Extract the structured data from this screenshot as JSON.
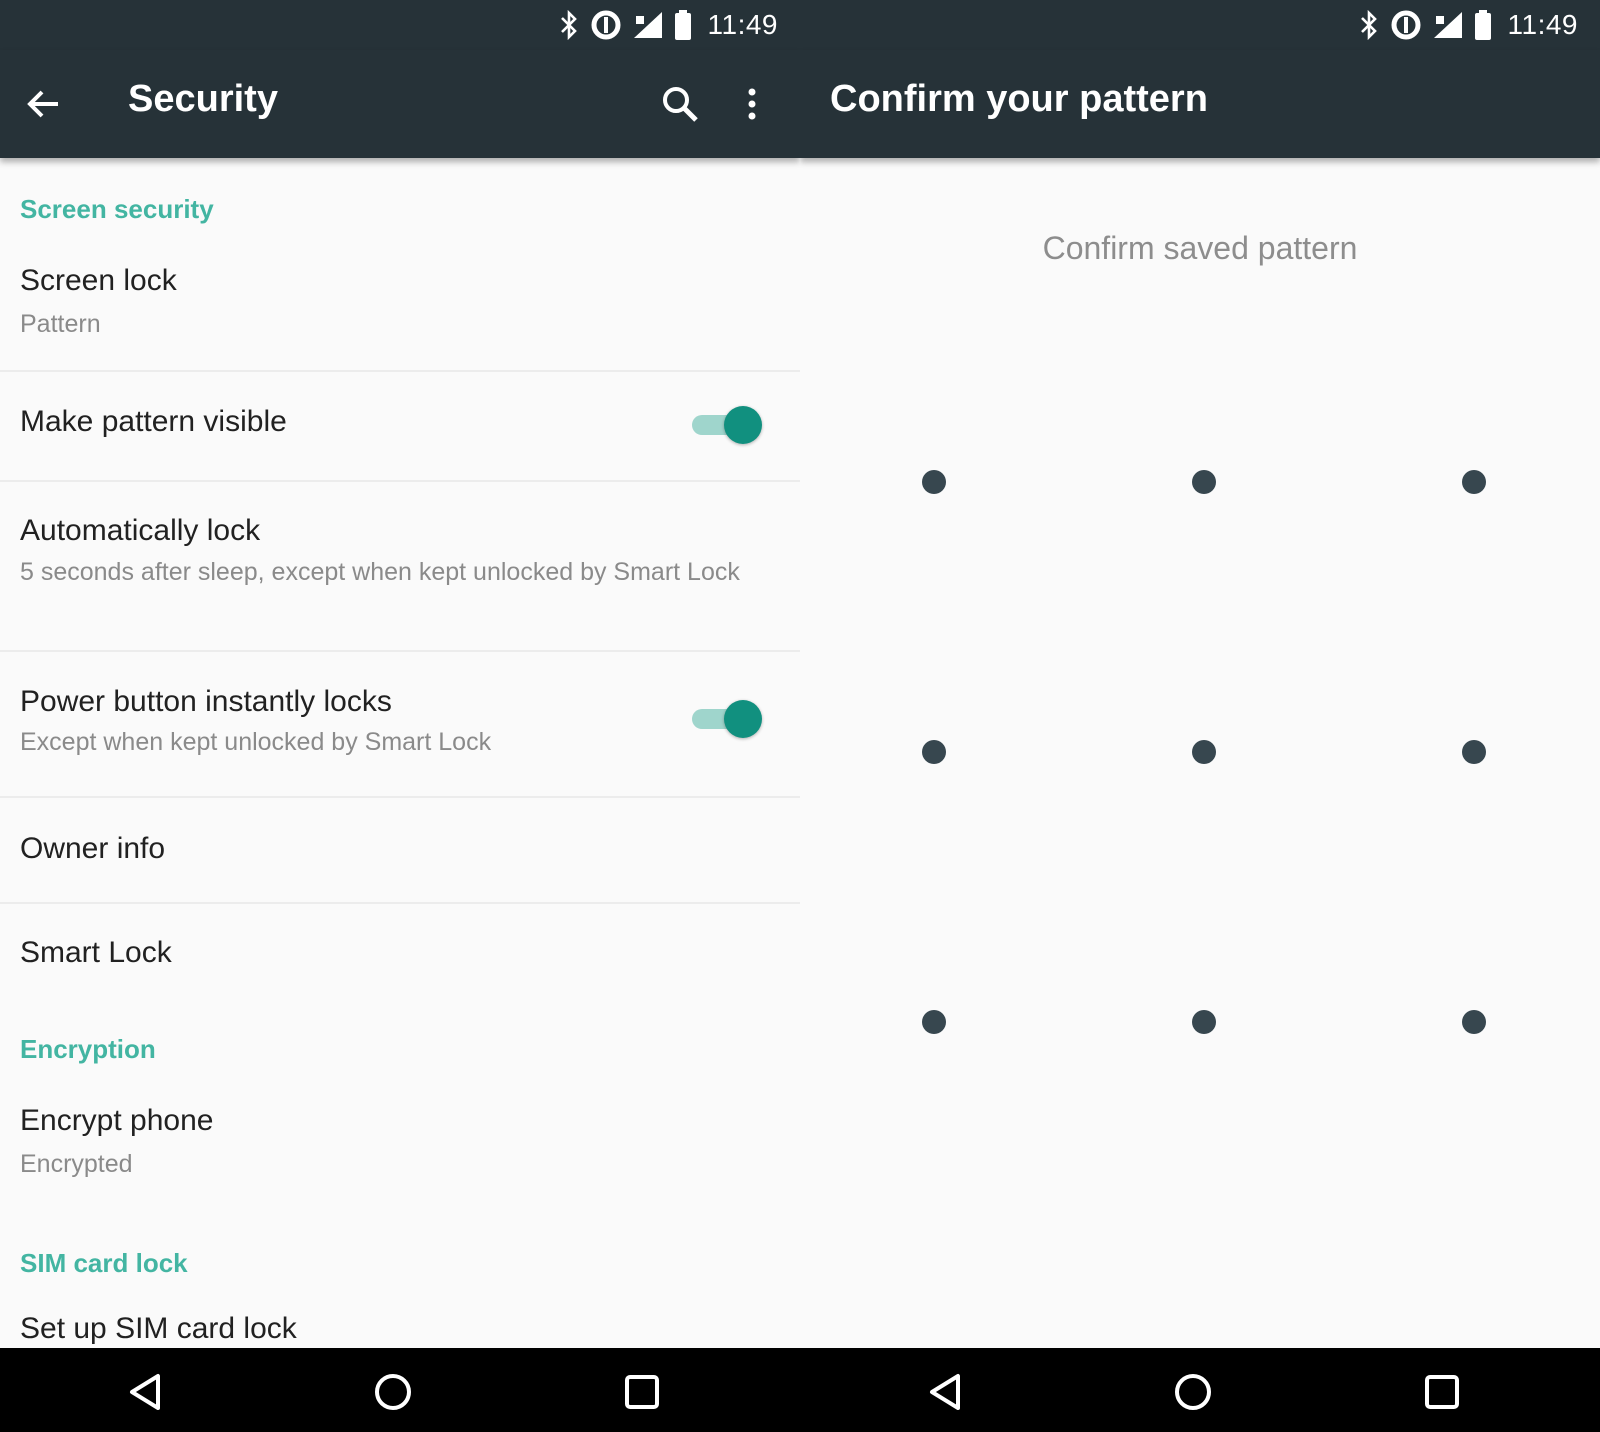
{
  "status_bar": {
    "time": "11:49",
    "icons": [
      "bluetooth-icon",
      "data-saver-icon",
      "signal-icon",
      "battery-icon"
    ]
  },
  "security": {
    "title": "Security",
    "sections": {
      "screen_security": "Screen security",
      "encryption": "Encryption",
      "sim_card_lock": "SIM card lock"
    },
    "items": {
      "screen_lock": {
        "title": "Screen lock",
        "subtitle": "Pattern"
      },
      "make_pattern_visible": {
        "title": "Make pattern visible",
        "enabled": true
      },
      "automatically_lock": {
        "title": "Automatically lock",
        "subtitle": "5 seconds after sleep, except when kept unlocked by Smart Lock"
      },
      "power_button_locks": {
        "title": "Power button instantly locks",
        "subtitle": "Except when kept unlocked by Smart Lock",
        "enabled": true
      },
      "owner_info": {
        "title": "Owner info"
      },
      "smart_lock": {
        "title": "Smart Lock"
      },
      "encrypt_phone": {
        "title": "Encrypt phone",
        "subtitle": "Encrypted"
      },
      "set_up_sim_lock": {
        "title": "Set up SIM card lock"
      }
    }
  },
  "confirm": {
    "title": "Confirm your pattern",
    "header": "Confirm saved pattern",
    "grid": {
      "rows": 3,
      "cols": 3
    }
  },
  "colors": {
    "app_bar": "#263238",
    "accent": "#11907f",
    "section_header": "#43b5a2",
    "pattern_dot": "#37474f",
    "nav_bar": "#000000"
  }
}
